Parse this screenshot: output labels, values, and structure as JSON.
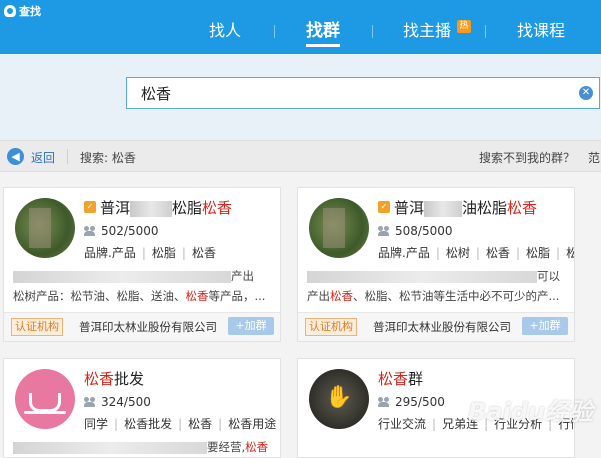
{
  "app": {
    "title": "查找"
  },
  "tabs": [
    {
      "label": "找人"
    },
    {
      "label": "找群"
    },
    {
      "label": "找主播",
      "badge": "热"
    },
    {
      "label": "找课程"
    }
  ],
  "search": {
    "value": "松香"
  },
  "breadcrumb": {
    "back_label": "返回",
    "search_label": "搜索: 松香",
    "not_found": "搜索不到我的群？",
    "extra": "范"
  },
  "cards": [
    {
      "name_prefix": "普洱",
      "name_mid": "松脂",
      "name_hl": "松香",
      "members": "502/5000",
      "tags": [
        "品牌.产品",
        "松脂",
        "松香"
      ],
      "desc_line1_end": "产出",
      "desc_line2_pre": "松树产品：松节油、松脂、送油、",
      "desc_line2_hl": "松香",
      "desc_line2_post": "等产品，...",
      "cert": "认证机构",
      "org": "普洱印太林业股份有限公司",
      "join": "+加群"
    },
    {
      "name_prefix": "普洱",
      "name_mid": "油松脂",
      "name_hl": "松香",
      "members": "508/5000",
      "tags": [
        "品牌.产品",
        "松树",
        "松香",
        "松脂",
        "松..."
      ],
      "desc_line1_end": "可以",
      "desc_line2_pre": "产出",
      "desc_line2_hl": "松香",
      "desc_line2_post": "、松脂、松节油等生活中必不可少的产...",
      "cert": "认证机构",
      "org": "普洱印太林业股份有限公司",
      "join": "+加群"
    },
    {
      "name_hl": "松香",
      "name_post": "批发",
      "members": "324/500",
      "tags": [
        "同学",
        "松香批发",
        "松香",
        "松香用途"
      ],
      "desc_line1_end": "要经营,",
      "desc_line1_hl": "松香"
    },
    {
      "name_hl": "松香",
      "name_post": "群",
      "members": "295/500",
      "tags": [
        "行业交流",
        "兄弟连",
        "行业分析",
        "行情"
      ]
    }
  ],
  "watermark": "Baidu经验"
}
